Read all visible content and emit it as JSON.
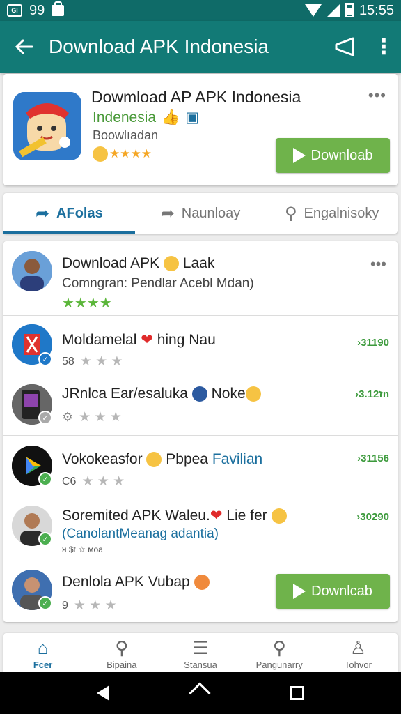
{
  "status_bar": {
    "sim_label": "Gl",
    "count": "99",
    "time": "15:55"
  },
  "app_bar": {
    "title": "Download APK Indonesia"
  },
  "featured": {
    "title": "Dowmload AP APK Indonesia",
    "subtitle": "Indenesia",
    "meta": "Boowlıadan",
    "rating_stars": "★★★★",
    "download_label": "Downloab"
  },
  "tabs": [
    {
      "label": "AFolas",
      "icon": "share-arrow-icon",
      "active": true
    },
    {
      "label": "Naunloay",
      "icon": "share-arrow-icon",
      "active": false
    },
    {
      "label": "Engalnisoky",
      "icon": "search-icon",
      "active": false
    }
  ],
  "list": [
    {
      "title": "Download APK",
      "title_after": "Laak",
      "sub": "Comngran: Pendlar Acebl Mdan)",
      "stars": "★★★★",
      "more": "•••"
    },
    {
      "title": "Moldamelal",
      "title_after": "hing Nau",
      "meta": "58",
      "count": "›31190"
    },
    {
      "title": "JRnlca Ear/esaluka",
      "title_after": "Noke",
      "count": "›3.1ז2n"
    },
    {
      "title": "Vokokeasfor",
      "title_after": "Pbpea",
      "title_link": "Favilian",
      "meta": "C6",
      "count": "›31156"
    },
    {
      "title": "Soremited APK Waleu.",
      "title_after": "Lie fer",
      "sub": "(CanolantMeanag adantia)",
      "meta": "ᴚ $t ☆ ᴍoa",
      "count": "›30290"
    },
    {
      "title": "Denlola APK Vubap",
      "meta": "9",
      "download_label": "Downlcab"
    }
  ],
  "bottom_nav": [
    {
      "label": "Fcer",
      "icon": "home-icon",
      "active": true
    },
    {
      "label": "Bipaina",
      "icon": "search-icon",
      "active": false
    },
    {
      "label": "Stansua",
      "icon": "list-icon",
      "active": false
    },
    {
      "label": "Pangunarry",
      "icon": "search-icon",
      "active": false
    },
    {
      "label": "Tohvor",
      "icon": "person-icon",
      "active": false
    }
  ],
  "colors": {
    "app_bar": "#127a76",
    "accent": "#1b6f9e",
    "download": "#6fb34b",
    "count_green": "#3c9a3c"
  }
}
